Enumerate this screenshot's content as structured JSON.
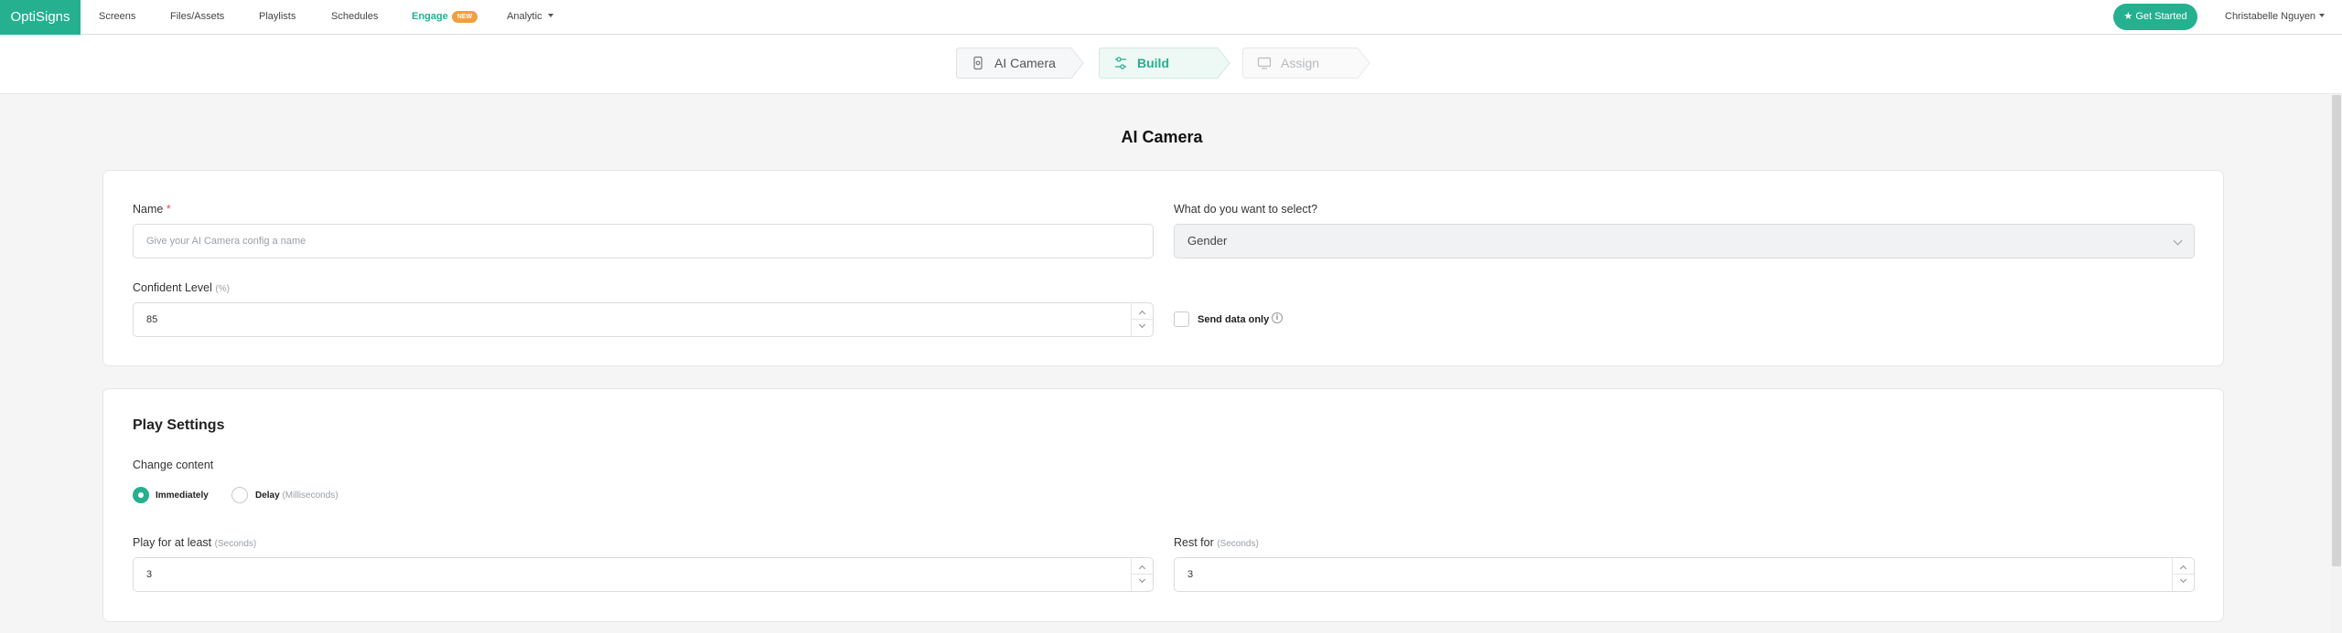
{
  "app": {
    "brand": "OptiSigns"
  },
  "nav": {
    "items": [
      "Screens",
      "Files/Assets",
      "Playlists",
      "Schedules"
    ],
    "engage": {
      "label": "Engage",
      "badge": "NEW"
    },
    "analytic": "Analytic",
    "get_started": "Get Started",
    "user": "Christabelle Nguyen"
  },
  "stepper": {
    "steps": [
      {
        "label": "AI Camera",
        "state": "done",
        "icon": "camera-device-icon"
      },
      {
        "label": "Build",
        "state": "active",
        "icon": "sliders-icon"
      },
      {
        "label": "Assign",
        "state": "disabled",
        "icon": "monitor-icon"
      }
    ]
  },
  "page": {
    "title": "AI Camera"
  },
  "config": {
    "name_label": "Name",
    "name_required": "*",
    "name_placeholder": "Give your AI Camera config a name",
    "select_label": "What do you want to select?",
    "select_value": "Gender",
    "confident_label": "Confident Level",
    "confident_unit": "(%)",
    "confident_value": "85",
    "send_data_label": "Send data only",
    "send_data_checked": false
  },
  "play": {
    "title": "Play Settings",
    "change_content_label": "Change content",
    "options": [
      {
        "label": "Immediately",
        "hint": "",
        "selected": true
      },
      {
        "label": "Delay",
        "hint": "(Milliseconds)",
        "selected": false
      }
    ],
    "play_label": "Play for at least",
    "play_unit": "(Seconds)",
    "play_value": "3",
    "rest_label": "Rest for",
    "rest_unit": "(Seconds)",
    "rest_value": "3"
  },
  "colors": {
    "accent": "#25b08f",
    "badge": "#f29f3f",
    "required": "#e5534b"
  }
}
